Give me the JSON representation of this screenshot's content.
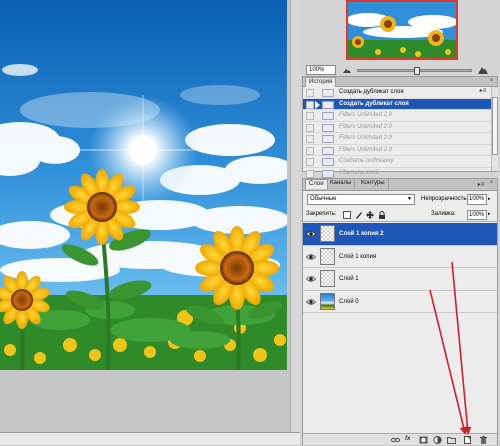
{
  "navigator": {
    "zoom_value": "100%",
    "zoom_out_icon": "mountain-small-icon",
    "zoom_in_icon": "mountain-large-icon"
  },
  "history": {
    "tab_label": "История",
    "close_glyph": "×",
    "menu_glyph": "▸≡",
    "items": [
      {
        "label": "Создать дубликат слоя",
        "state": "normal"
      },
      {
        "label": "Создать дубликат слоя",
        "state": "active"
      },
      {
        "label": "Filters Unlimited 2.0",
        "state": "dim"
      },
      {
        "label": "Filters Unlimited 2.0",
        "state": "dim"
      },
      {
        "label": "Filters Unlimited 2.0",
        "state": "dim"
      },
      {
        "label": "Filters Unlimited 2.0",
        "state": "dim"
      },
      {
        "label": "Создать подсказку",
        "state": "dim"
      },
      {
        "label": "Удалить слой",
        "state": "dim"
      }
    ]
  },
  "layers": {
    "tabs": [
      "Слои",
      "Каналы",
      "Контуры"
    ],
    "close_glyph": "×",
    "menu_glyph": "▸≡",
    "blend_mode": "Обычные",
    "opacity_label": "Непрозрачность:",
    "opacity_value": "100%",
    "lock_label": "Закрепить:",
    "fill_label": "Заливка:",
    "fill_value": "100%",
    "items": [
      {
        "name": "Слой 1 копия 2",
        "active": true,
        "thumb": "checker"
      },
      {
        "name": "Слой 1 копия",
        "active": false,
        "thumb": "checker"
      },
      {
        "name": "Слой 1",
        "active": false,
        "thumb": "checker"
      },
      {
        "name": "Слой 0",
        "active": false,
        "thumb": "photo"
      }
    ],
    "footer_icons": [
      "link-layers-icon",
      "fx-icon",
      "mask-icon",
      "adjustment-layer-icon",
      "group-folder-icon",
      "new-layer-icon",
      "trash-icon"
    ]
  },
  "colors": {
    "selection_blue": "#1f57b8",
    "arrow_red": "#d0202a",
    "panel_bg": "#ececec"
  }
}
